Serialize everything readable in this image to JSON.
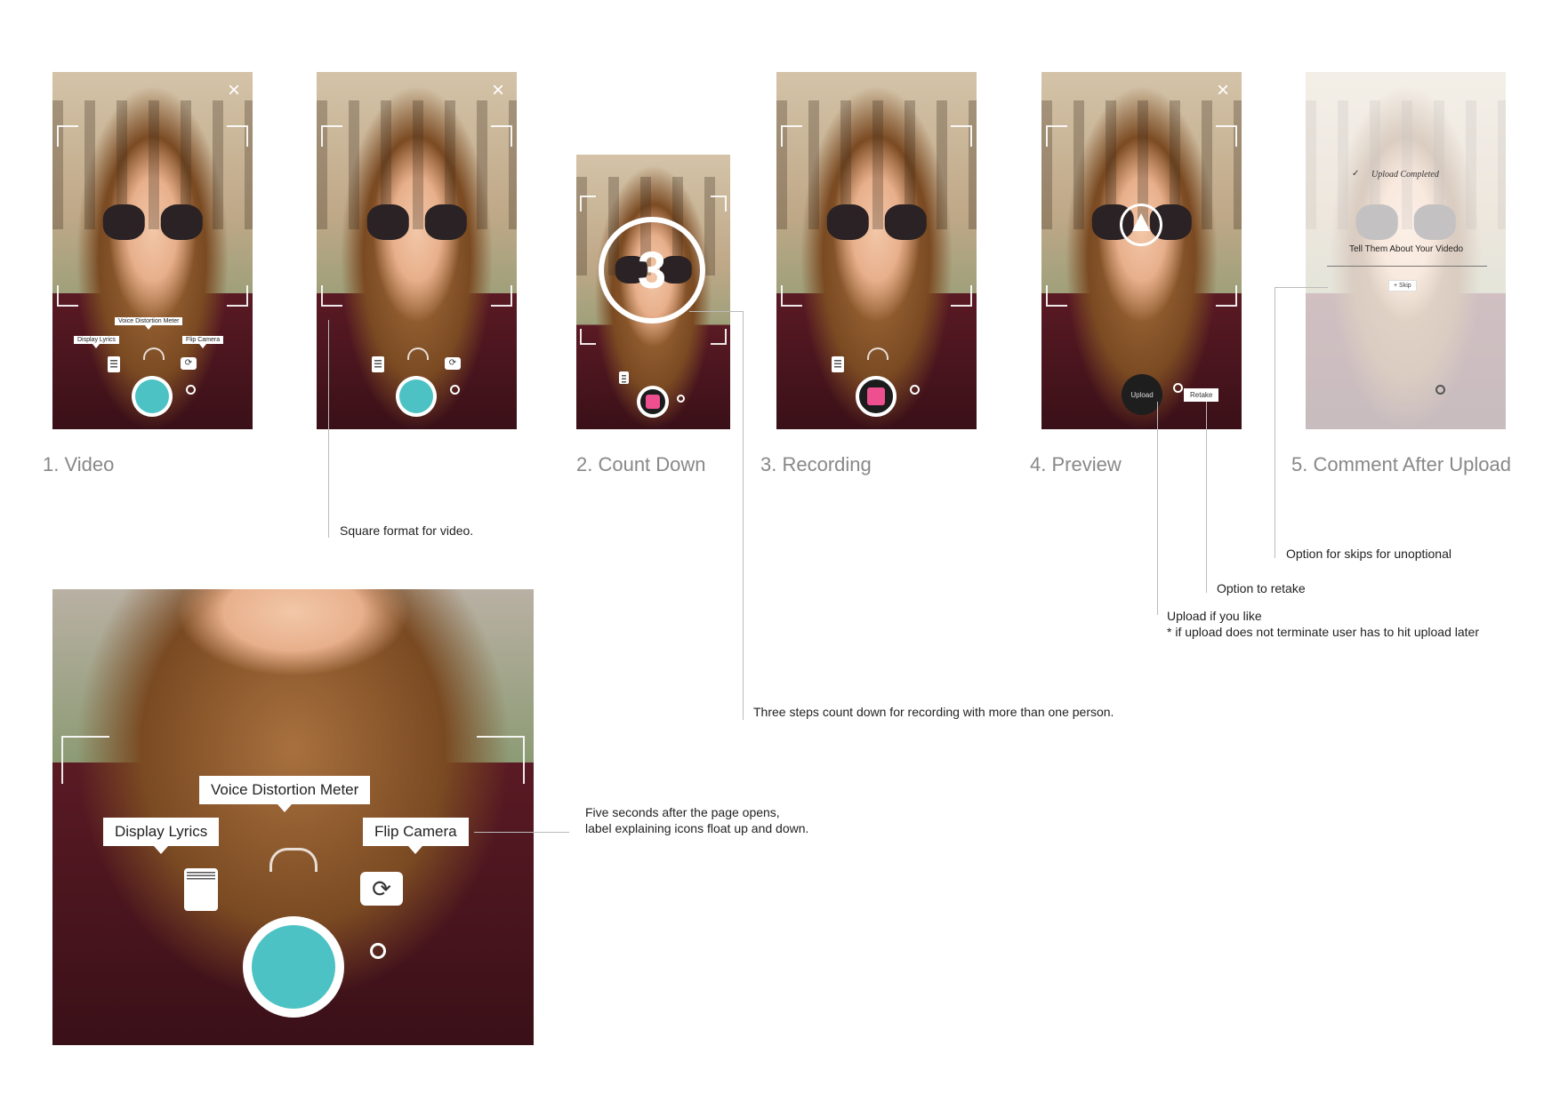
{
  "steps": {
    "video": "1. Video",
    "countdown": "2. Count Down",
    "recording": "3. Recording",
    "preview": "4. Preview",
    "comment": "5. Comment After Upload"
  },
  "labels": {
    "voice_meter": "Voice Distortion Meter",
    "display_lyrics": "Display Lyrics",
    "flip_camera": "Flip Camera"
  },
  "countdown": {
    "number": "3"
  },
  "preview": {
    "upload": "Upload",
    "retake": "Retake"
  },
  "comment": {
    "upload_completed": "Upload Completed",
    "check": "✓",
    "prompt": "Tell Them About Your Videdo",
    "skip": "Skip",
    "skip_icon": "+"
  },
  "icons": {
    "close": "×",
    "flip": "⟳"
  },
  "notes": {
    "square": "Square format for video.",
    "skip": "Option for skips for unoptional",
    "retake": "Option to retake",
    "upload_1": "Upload if you like",
    "upload_2": "* if upload does not terminate user has to hit upload later",
    "countdown": "Three steps count down for recording with more than one person.",
    "float_1": "Five seconds after the page opens,",
    "float_2": "label explaining icons float up and down."
  },
  "colors": {
    "record": "#4cc2c4",
    "stop": "#ee4f8f"
  }
}
